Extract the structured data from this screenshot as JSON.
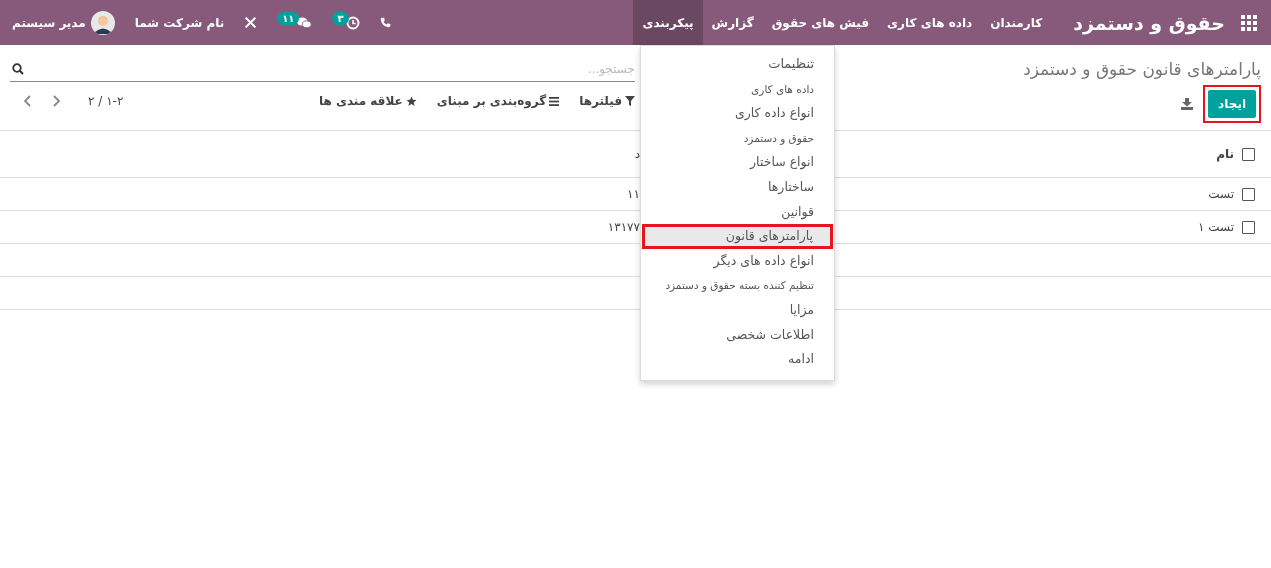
{
  "navbar": {
    "brand": "حقوق و دستمزد",
    "menus": [
      {
        "label": "کارمندان",
        "selected": false
      },
      {
        "label": "داده های کاری",
        "selected": false
      },
      {
        "label": "فیش های حقوق",
        "selected": false
      },
      {
        "label": "گزارش",
        "selected": false
      },
      {
        "label": "پیکربندی",
        "selected": true
      }
    ],
    "activity_count": "۳",
    "message_count": "۱۱",
    "company": "نام شرکت شما",
    "user": "مدیر سیستم"
  },
  "breadcrumb": "پارامترهای قانون حقوق و دستمزد",
  "search": {
    "placeholder": "جستجو..."
  },
  "create_button": {
    "label": "ایجاد",
    "highlighted": true
  },
  "filters": [
    "فیلترها",
    "گروه‌بندی بر مبنای",
    "علاقه مندی ها"
  ],
  "pager": "۱-۲ / ۲",
  "table": {
    "select_all_checked": false,
    "columns": [
      "نام",
      "د"
    ],
    "rows": [
      {
        "cells": [
          "تست",
          "۱۱"
        ],
        "checked": false
      },
      {
        "cells": [
          "تست ۱",
          "۱۳۱۷۷"
        ],
        "checked": false
      }
    ]
  },
  "dropdown": [
    {
      "label": "تنظیمات",
      "kind": "section",
      "selected": false
    },
    {
      "label": "داده های کاری",
      "kind": "group",
      "selected": false
    },
    {
      "label": "انواع داده کاری",
      "kind": "item",
      "selected": false
    },
    {
      "label": "حقوق و دستمزد",
      "kind": "group",
      "selected": false
    },
    {
      "label": "انواع ساختار",
      "kind": "item",
      "selected": false
    },
    {
      "label": "ساختارها",
      "kind": "item",
      "selected": false
    },
    {
      "label": "قوانین",
      "kind": "item",
      "selected": false
    },
    {
      "label": "پارامترهای قانون",
      "kind": "item",
      "selected": true
    },
    {
      "label": "انواع داده های دیگر",
      "kind": "item",
      "selected": false
    },
    {
      "label": "تنظیم کننده بسته حقوق و دستمزد",
      "kind": "group",
      "selected": false
    },
    {
      "label": "مزایا",
      "kind": "item",
      "selected": false
    },
    {
      "label": "اطلاعات شخصی",
      "kind": "item",
      "selected": false
    },
    {
      "label": "ادامه",
      "kind": "item",
      "selected": false
    }
  ]
}
